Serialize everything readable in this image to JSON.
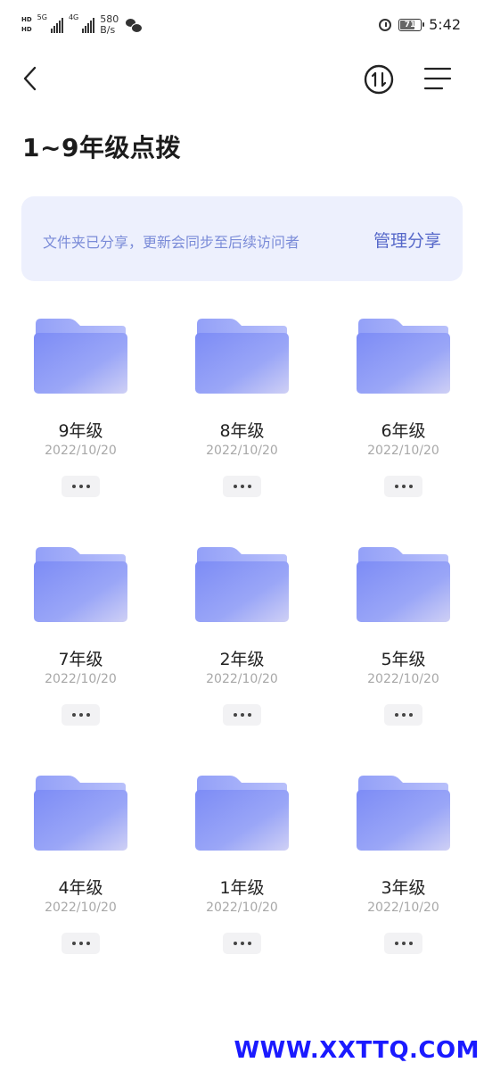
{
  "status_bar": {
    "sim1": "HD",
    "sim2": "HD",
    "net1": "5G",
    "net2": "4G",
    "speed_value": "580",
    "speed_unit": "B/s",
    "battery": "71",
    "time": "5:42"
  },
  "page": {
    "title": "1~9年级点拨"
  },
  "banner": {
    "text": "文件夹已分享，更新会同步至后续访问者",
    "button": "管理分享"
  },
  "folders": [
    {
      "name": "9年级",
      "date": "2022/10/20"
    },
    {
      "name": "8年级",
      "date": "2022/10/20"
    },
    {
      "name": "6年级",
      "date": "2022/10/20"
    },
    {
      "name": "7年级",
      "date": "2022/10/20"
    },
    {
      "name": "2年级",
      "date": "2022/10/20"
    },
    {
      "name": "5年级",
      "date": "2022/10/20"
    },
    {
      "name": "4年级",
      "date": "2022/10/20"
    },
    {
      "name": "1年级",
      "date": "2022/10/20"
    },
    {
      "name": "3年级",
      "date": "2022/10/20"
    }
  ],
  "icons": {
    "back": "chevron-left-icon",
    "sort": "sort-icon",
    "menu": "menu-icon",
    "folder": "folder-icon",
    "more": "more-icon"
  },
  "colors": {
    "banner_bg": "#edf0fd",
    "banner_text": "#7a8bd8",
    "accent": "#5668c9",
    "folder_front": "#8a95f5",
    "folder_back": "#a3aff9"
  },
  "watermark": "WWW.XXTTQ.COM"
}
